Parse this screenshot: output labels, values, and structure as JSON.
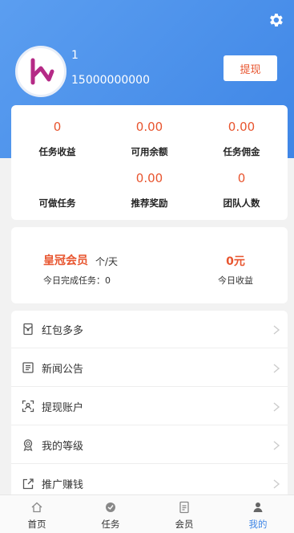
{
  "profile": {
    "name": "1",
    "phone": "15000000000",
    "withdraw_label": "提现"
  },
  "stats": [
    {
      "value": "0",
      "label": "任务收益"
    },
    {
      "value": "0.00",
      "label": "可用余额"
    },
    {
      "value": "0.00",
      "label": "任务佣金"
    },
    {
      "value": "",
      "label": "可做任务"
    },
    {
      "value": "0.00",
      "label": "推荐奖励"
    },
    {
      "value": "0",
      "label": "团队人数"
    }
  ],
  "vip": {
    "title": "皇冠会员",
    "unit": "个/天",
    "completed_today": "今日完成任务：0",
    "earnings_value": "0元",
    "earnings_label": "今日收益"
  },
  "menu": [
    {
      "label": "红包多多",
      "icon": "red-envelope-icon"
    },
    {
      "label": "新闻公告",
      "icon": "news-icon"
    },
    {
      "label": "提现账户",
      "icon": "scan-account-icon"
    },
    {
      "label": "我的等级",
      "icon": "medal-icon"
    },
    {
      "label": "推广赚钱",
      "icon": "share-icon"
    }
  ],
  "tabs": [
    {
      "label": "首页",
      "icon": "home-icon"
    },
    {
      "label": "任务",
      "icon": "task-icon"
    },
    {
      "label": "会员",
      "icon": "member-icon"
    },
    {
      "label": "我的",
      "icon": "profile-icon",
      "active": true
    }
  ],
  "colors": {
    "header": "#4a8fec",
    "accent": "#e8552f",
    "tab_active": "#3f86e6"
  }
}
